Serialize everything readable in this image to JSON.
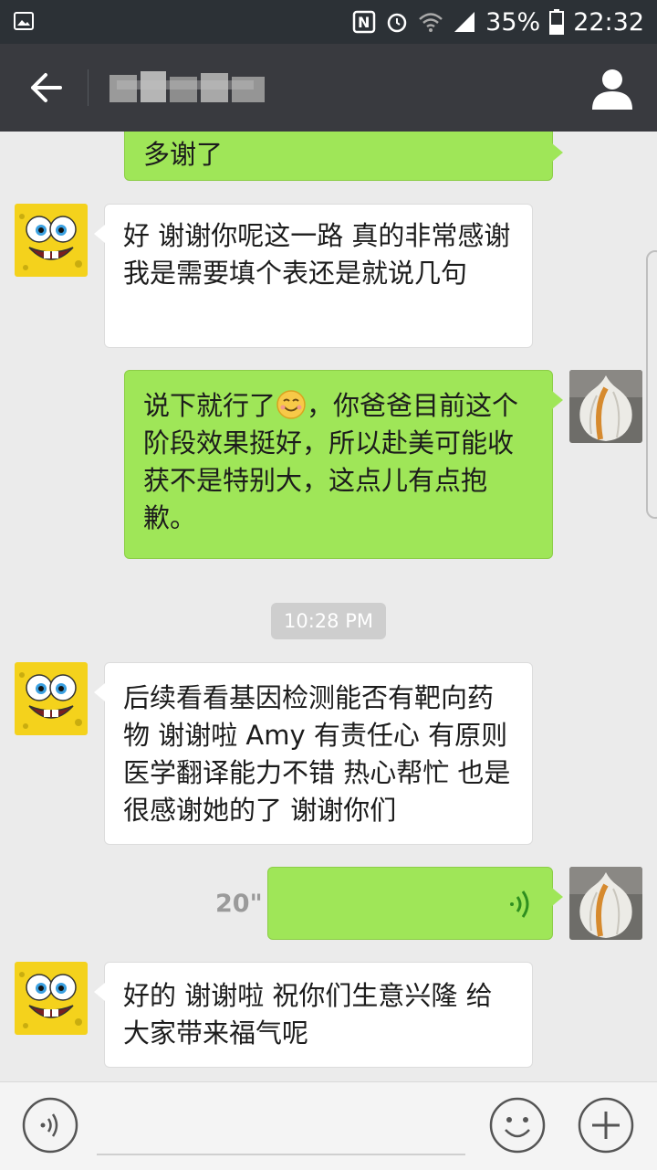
{
  "status_bar": {
    "battery": "35%",
    "time": "22:32",
    "icons": [
      "gallery-icon",
      "nfc-icon",
      "alarm-icon",
      "wifi-icon",
      "signal-icon",
      "battery-icon"
    ]
  },
  "app_bar": {
    "back_icon": "back-arrow-icon",
    "profile_icon": "person-icon"
  },
  "messages": [
    {
      "side": "right",
      "text": "多谢了"
    },
    {
      "side": "left",
      "text": "好 谢谢你呢这一路 真的非常感谢 我是需要填个表还是就说几句"
    },
    {
      "side": "right",
      "text_before_emoji": "说下就行了",
      "emoji": "smile-emoji-icon",
      "text_after_emoji": "，你爸爸目前这个阶段效果挺好，所以赴美可能收获不是特别大，这点儿有点抱歉。"
    },
    {
      "type": "timestamp",
      "text": "10:28 PM"
    },
    {
      "side": "left",
      "text": "后续看看基因检测能否有靶向药物 谢谢啦 Amy 有责任心 有原则 医学翻译能力不错 热心帮忙 也是很感谢她的了 谢谢你们"
    },
    {
      "side": "right",
      "type": "voice",
      "duration": "20\"",
      "icon": "voice-wave-icon"
    },
    {
      "side": "left",
      "text": "好的 谢谢啦 祝你们生意兴隆 给大家带来福气呢"
    }
  ],
  "input_bar": {
    "voice_icon": "voice-toggle-icon",
    "emoji_icon": "emoji-icon",
    "plus_icon": "plus-icon"
  }
}
